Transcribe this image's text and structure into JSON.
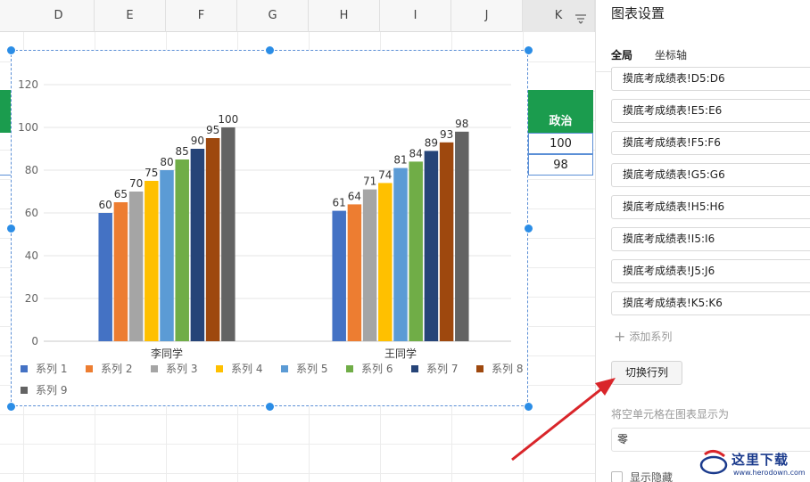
{
  "sheet": {
    "columns": [
      "D",
      "E",
      "F",
      "G",
      "H",
      "I",
      "J",
      "K"
    ],
    "header_cell": "政治",
    "values": [
      "100",
      "98"
    ]
  },
  "chart_data": {
    "type": "bar",
    "categories": [
      "李同学",
      "王同学"
    ],
    "series": [
      {
        "name": "系列 1",
        "color": "#4472c4",
        "values": [
          60,
          61
        ]
      },
      {
        "name": "系列 2",
        "color": "#ed7d31",
        "values": [
          65,
          64
        ]
      },
      {
        "name": "系列 3",
        "color": "#a5a5a5",
        "values": [
          70,
          71
        ]
      },
      {
        "name": "系列 4",
        "color": "#ffc000",
        "values": [
          75,
          74
        ]
      },
      {
        "name": "系列 5",
        "color": "#5b9bd5",
        "values": [
          80,
          81
        ]
      },
      {
        "name": "系列 6",
        "color": "#70ad47",
        "values": [
          85,
          84
        ]
      },
      {
        "name": "系列 7",
        "color": "#264478",
        "values": [
          90,
          89
        ]
      },
      {
        "name": "系列 8",
        "color": "#9e480e",
        "values": [
          95,
          93
        ]
      },
      {
        "name": "系列 9",
        "color": "#636363",
        "values": [
          100,
          98
        ]
      }
    ],
    "yticks": [
      0,
      20,
      40,
      60,
      80,
      100,
      120
    ],
    "ylim": [
      0,
      120
    ],
    "grid": true,
    "legend": "bottom"
  },
  "panel": {
    "title": "图表设置",
    "tabs": [
      "全局",
      "坐标轴"
    ],
    "series_ranges": [
      "摸底考成绩表!D5:D6",
      "摸底考成绩表!E5:E6",
      "摸底考成绩表!F5:F6",
      "摸底考成绩表!G5:G6",
      "摸底考成绩表!H5:H6",
      "摸底考成绩表!I5:I6",
      "摸底考成绩表!J5:J6",
      "摸底考成绩表!K5:K6"
    ],
    "add_series": "添加系列",
    "switch_button": "切换行列",
    "empty_cells_label": "将空单元格在图表显示为",
    "empty_cells_value": "零",
    "hidden_label": "显示隐藏"
  },
  "watermark": {
    "text": "这里下载",
    "site": "www.herodown.com"
  },
  "colors": {
    "accent": "#1b9c4e",
    "handle": "#2b8de6",
    "arrow": "#d9252a"
  }
}
